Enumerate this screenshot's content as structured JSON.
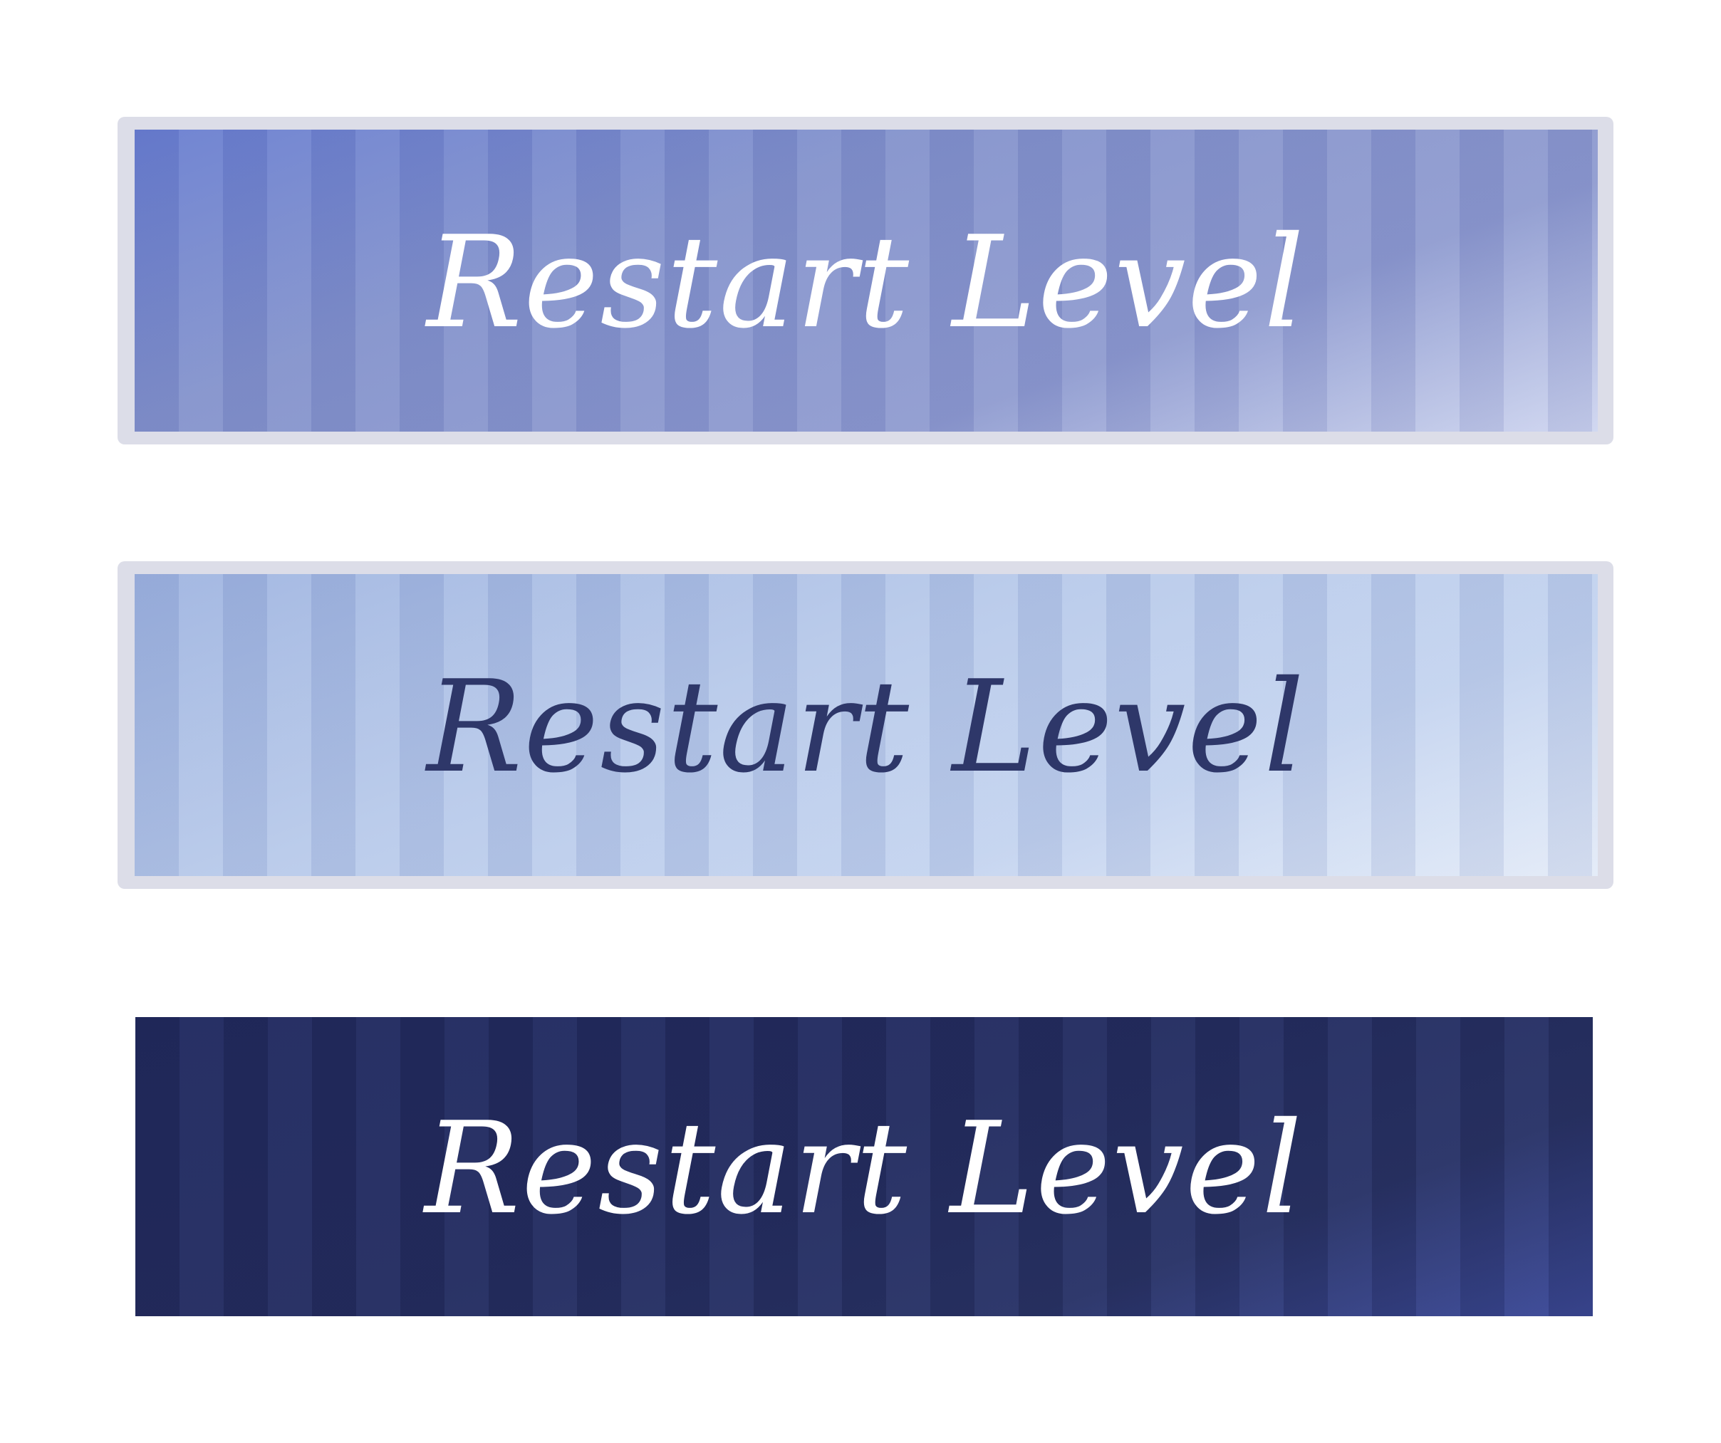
{
  "buttons": [
    {
      "label": "Restart Level",
      "state": "normal",
      "colors": {
        "background": "#8493cc",
        "text": "#ffffff",
        "frame": "#dcdde8"
      }
    },
    {
      "label": "Restart Level",
      "state": "hover",
      "colors": {
        "background": "#b7c9ea",
        "text": "#2e3769",
        "frame": "#dcdde8"
      }
    },
    {
      "label": "Restart Level",
      "state": "pressed",
      "colors": {
        "background": "#262f63",
        "text": "#ffffff"
      }
    }
  ]
}
